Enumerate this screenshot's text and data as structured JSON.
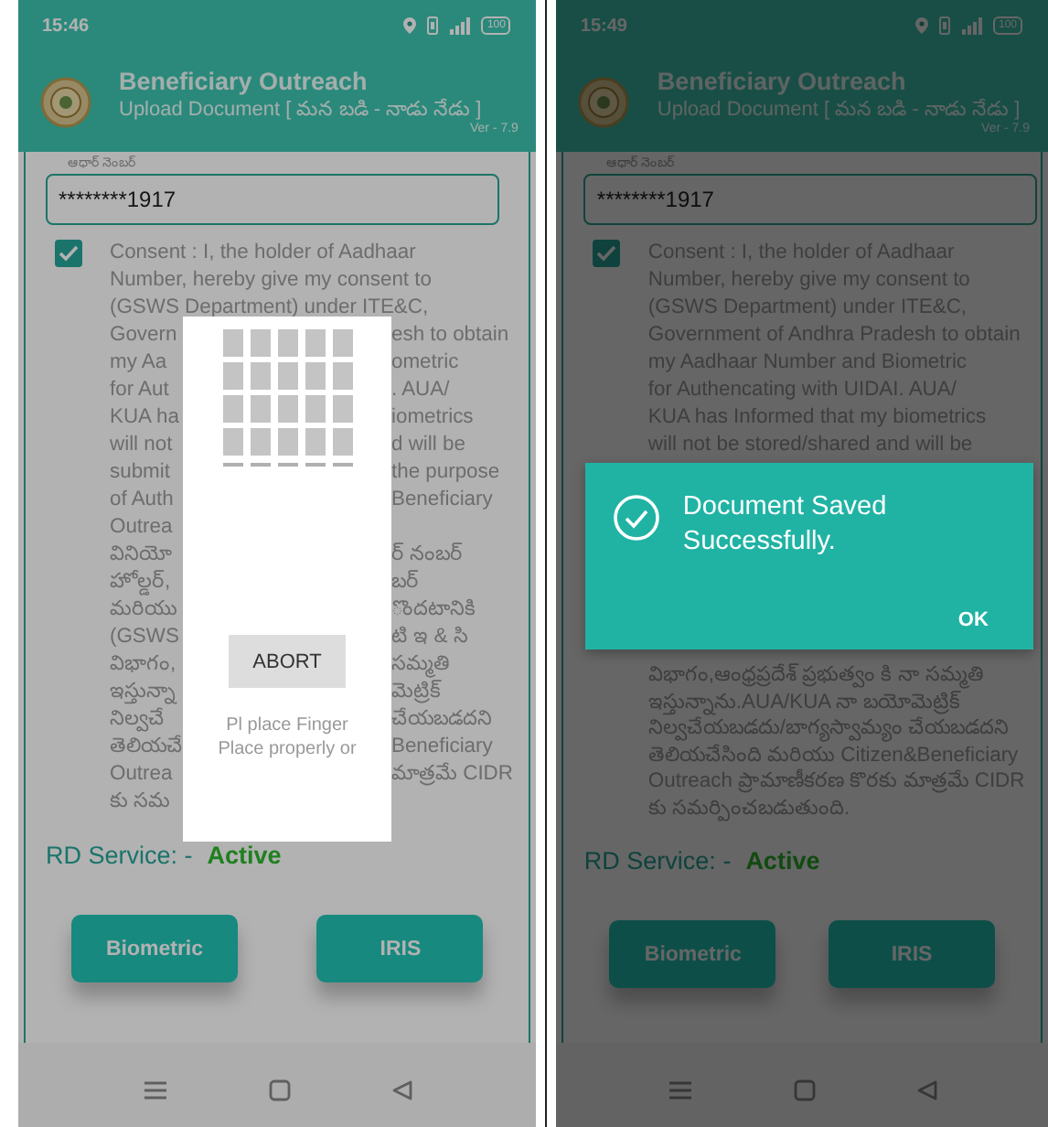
{
  "screens": [
    {
      "status_bar": {
        "time": "15:46",
        "battery": "100"
      },
      "header": {
        "title": "Beneficiary Outreach",
        "subtitle": "Upload Document [ మన బడి - నాడు నేడు ]",
        "version": "Ver - 7.9"
      },
      "aadhaar": {
        "label": "ఆధార్ నెంబర్",
        "value": "********1917"
      },
      "consent": {
        "checked": true,
        "lines": [
          {
            "kind": "full",
            "text": "Consent : I, the holder of Aadhaar"
          },
          {
            "kind": "full",
            "text": "Number, hereby give my consent to"
          },
          {
            "kind": "full",
            "text": "(GSWS Department) under ITE&C,"
          },
          {
            "kind": "split",
            "left": "Govern",
            "right": "esh to obtain"
          },
          {
            "kind": "split",
            "left": "my Aa",
            "right": "ometric"
          },
          {
            "kind": "split",
            "left": "for Aut",
            "right": ". AUA/"
          },
          {
            "kind": "split",
            "left": "KUA ha",
            "right": "iometrics"
          },
          {
            "kind": "split",
            "left": "will not",
            "right": "d will be"
          },
          {
            "kind": "split",
            "left": "submit",
            "right": "the purpose"
          },
          {
            "kind": "split",
            "left": "of Auth",
            "right": "Beneficiary"
          },
          {
            "kind": "split",
            "left": "Outrea"
          },
          {
            "kind": "split",
            "left": "వినియో",
            "right": "ర్ నంబర్"
          },
          {
            "kind": "split",
            "left": "హోల్డర్,",
            "right": "బర్"
          },
          {
            "kind": "split",
            "left": "మరియు",
            "right": "ొందటానికి"
          },
          {
            "kind": "split",
            "left": "(GSWS",
            "right": "టి ఇ & సి"
          },
          {
            "kind": "split",
            "left": "విభాగం,",
            "right": "సమ్మతి"
          },
          {
            "kind": "split",
            "left": "ఇస్తున్నా",
            "right": "మెట్రిక్"
          },
          {
            "kind": "split",
            "left": "నిల్వచే",
            "right": "చేయబడదని"
          },
          {
            "kind": "split",
            "left": "తెలియచే",
            "right": "Beneficiary"
          },
          {
            "kind": "split",
            "left": "Outrea",
            "right": "మాత్రమే CIDR"
          },
          {
            "kind": "split",
            "left": "కు సమ"
          }
        ]
      },
      "rd_service": {
        "label": "RD Service: -",
        "value": "Active"
      },
      "buttons": [
        "Biometric",
        "IRIS"
      ],
      "dialog": {
        "kind": "fingerprint",
        "button": "ABORT",
        "message": [
          "Pl place Finger",
          "Place properly or"
        ]
      }
    },
    {
      "status_bar": {
        "time": "15:49",
        "battery": "100"
      },
      "header": {
        "title": "Beneficiary Outreach",
        "subtitle": "Upload Document [ మన బడి - నాడు నేడు ]",
        "version": "Ver - 7.9"
      },
      "aadhaar": {
        "label": "ఆధార్ నెంబర్",
        "value": "********1917"
      },
      "consent": {
        "checked": true,
        "lines": [
          {
            "kind": "full",
            "text": "Consent : I, the holder of Aadhaar"
          },
          {
            "kind": "full",
            "text": "Number, hereby give my consent to"
          },
          {
            "kind": "full",
            "text": "(GSWS Department) under ITE&C,"
          },
          {
            "kind": "full",
            "text": "Government of Andhra Pradesh to obtain"
          },
          {
            "kind": "full",
            "text": "my Aadhaar Number and Biometric"
          },
          {
            "kind": "full",
            "text": "for Authencating with UIDAI. AUA/"
          },
          {
            "kind": "full",
            "text": "KUA has Informed that my biometrics"
          },
          {
            "kind": "full",
            "text": "will not be stored/shared and will be"
          }
        ],
        "lines_after": [
          "విభాగం,ఆంధ్రప్రదేశ్ ప్రభుత్వం కి నా సమ్మతి",
          "ఇస్తున్నాను.AUA/KUA నా బయోమెట్రిక్",
          "నిల్వచేయబడదు/బాగ్యస్వామ్యం చేయబడదని",
          "తెలియచేసింది మరియు Citizen&Beneficiary",
          "Outreach ప్రామాణీకరణ కొరకు మాత్రమే CIDR",
          "కు సమర్పించబడుతుంది."
        ]
      },
      "rd_service": {
        "label": "RD Service: -",
        "value": "Active"
      },
      "buttons": [
        "Biometric",
        "IRIS"
      ],
      "dialog": {
        "kind": "message",
        "message": "Document Saved Successfully.",
        "button": "OK"
      }
    }
  ]
}
